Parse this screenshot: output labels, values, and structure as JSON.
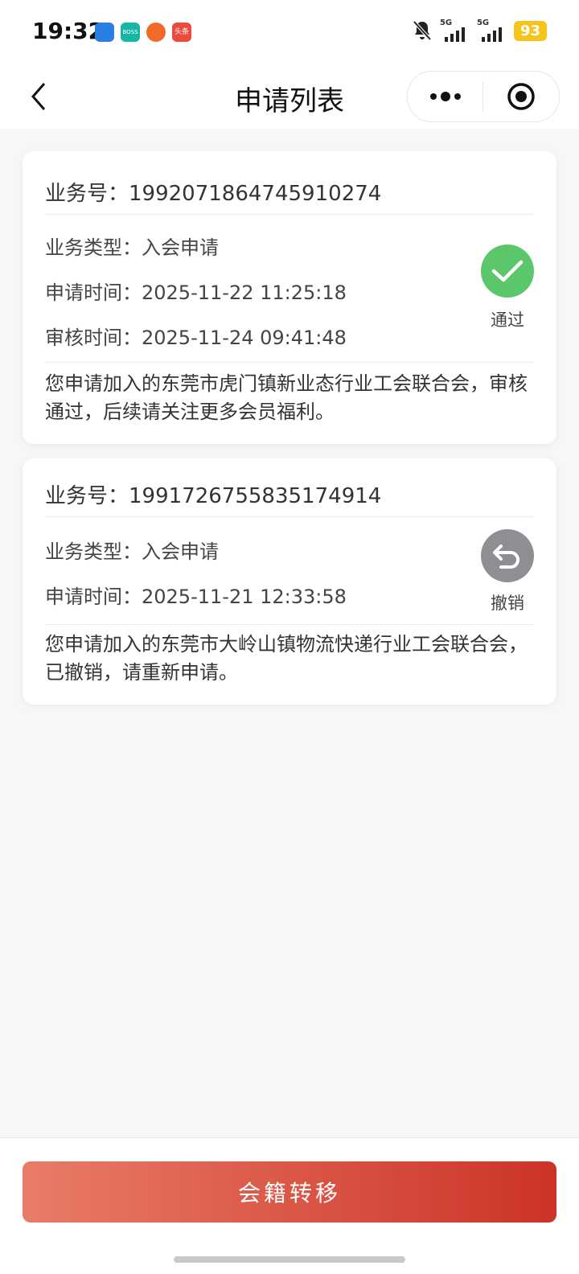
{
  "status_bar": {
    "time": "19:32",
    "apps": [
      {
        "name": "app-blue-icon",
        "text": "",
        "color": "#2a7de1"
      },
      {
        "name": "boss-app-icon",
        "text": "BOSS",
        "color": "#19b5a4"
      },
      {
        "name": "orange-app-icon",
        "text": "",
        "color": "#f06b2a"
      },
      {
        "name": "toutiao-app-icon",
        "text": "头条",
        "color": "#e94b3c"
      }
    ],
    "network_1": "5G",
    "network_2": "5G",
    "battery": "93"
  },
  "nav": {
    "title": "申请列表"
  },
  "records": [
    {
      "id_label": "业务号：",
      "id_value": "1992071864745910274",
      "type_label": "业务类型：",
      "type_value": "入会申请",
      "apply_label": "申请时间：",
      "apply_time": "2025-11-22 11:25:18",
      "review_label": "审核时间：",
      "review_time": "2025-11-24 09:41:48",
      "status": "通过",
      "status_color": "#5cc66b",
      "description": "您申请加入的东莞市虎门镇新业态行业工会联合会，审核通过，后续请关注更多会员福利。"
    },
    {
      "id_label": "业务号：",
      "id_value": "1991726755835174914",
      "type_label": "业务类型：",
      "type_value": "入会申请",
      "apply_label": "申请时间：",
      "apply_time": "2025-11-21 12:33:58",
      "status": "撤销",
      "status_color": "#8e8e93",
      "description": "您申请加入的东莞市大岭山镇物流快递行业工会联合会，已撤销，请重新申请。"
    }
  ],
  "footer": {
    "button_label": "会籍转移",
    "gradient_start": "#e97c68",
    "gradient_end": "#cc3328"
  }
}
